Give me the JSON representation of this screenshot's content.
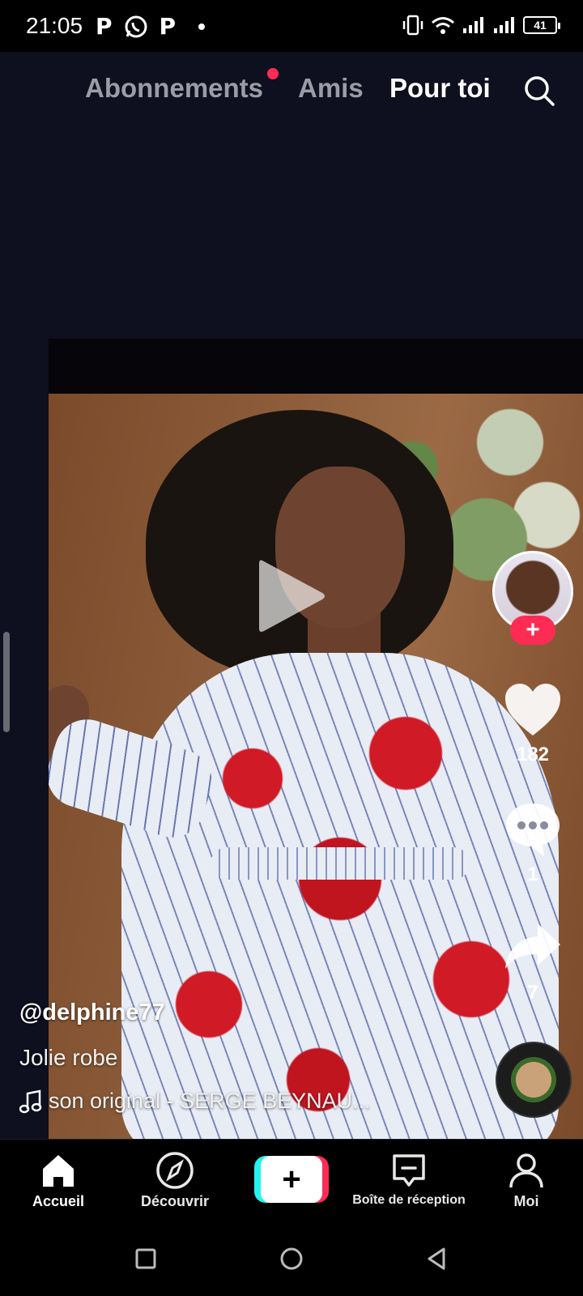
{
  "status_bar": {
    "time": "21:05",
    "left_icons": [
      "p-notification-icon",
      "whatsapp-icon",
      "p-notification-icon",
      "dot-icon"
    ],
    "p_glyph": "P",
    "battery": "41",
    "right_icons": [
      "vibrate-icon",
      "wifi-icon",
      "signal-icon",
      "signal-icon",
      "battery-icon"
    ]
  },
  "top_nav": {
    "tabs": [
      {
        "label": "Abonnements",
        "active": false,
        "has_dot": true
      },
      {
        "label": "Amis",
        "active": false
      },
      {
        "label": "Pour toi",
        "active": true
      }
    ],
    "search_icon": "search-icon"
  },
  "video": {
    "state": "paused",
    "play_icon": "play-icon"
  },
  "actions": {
    "follow_label": "+",
    "likes": "182",
    "comments": "1",
    "shares": "7"
  },
  "post": {
    "username": "@delphine77",
    "caption": "Jolie robe",
    "sound": "son original - SERGE BEYNAU..."
  },
  "bottom_nav": {
    "items": [
      {
        "label": "Accueil",
        "icon": "home-icon",
        "active": true
      },
      {
        "label": "Découvrir",
        "icon": "compass-icon",
        "active": false
      },
      {
        "label": "+",
        "icon": "create-icon",
        "active": false
      },
      {
        "label": "Boîte de réception",
        "icon": "inbox-icon",
        "active": false
      },
      {
        "label": "Moi",
        "icon": "profile-icon",
        "active": false
      }
    ]
  },
  "colors": {
    "accent_red": "#fe2c55",
    "accent_cyan": "#25f4ee",
    "feed_background": "#0e0f1f"
  }
}
